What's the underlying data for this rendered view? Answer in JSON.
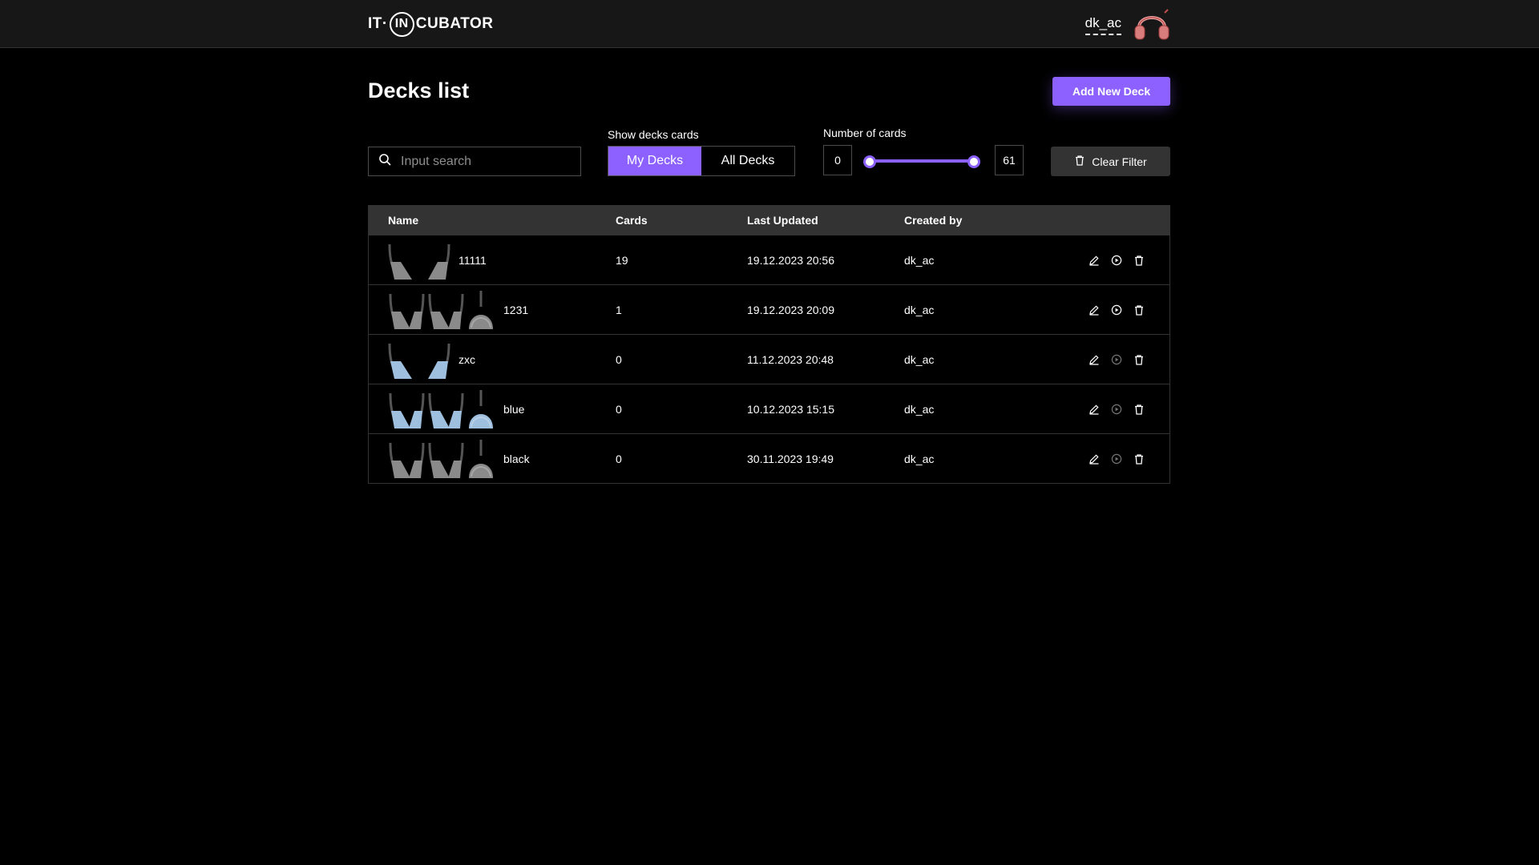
{
  "header": {
    "logo": {
      "left": "IT·",
      "circle": "IN",
      "right": "CUBATOR"
    },
    "user_name": "dk_ac",
    "avatar_icon": "headphones-avatar-icon"
  },
  "page": {
    "title": "Decks list",
    "add_button": "Add New Deck"
  },
  "filters": {
    "search_placeholder": "Input search",
    "search_value": "",
    "toggle_label": "Show decks cards",
    "toggle_options": [
      "My Decks",
      "All Decks"
    ],
    "toggle_selected": "My Decks",
    "range_label": "Number of cards",
    "range_min": "0",
    "range_max": "61",
    "clear_button": "Clear Filter"
  },
  "table": {
    "headers": [
      "Name",
      "Cards",
      "Last Updated",
      "Created by"
    ],
    "rows": [
      {
        "name": "11111",
        "cards": "19",
        "updated": "19.12.2023 20:56",
        "creator": "dk_ac",
        "learn_enabled": true,
        "color": "#8a8a8a"
      },
      {
        "name": "1231",
        "cards": "1",
        "updated": "19.12.2023 20:09",
        "creator": "dk_ac",
        "learn_enabled": true,
        "color": "#8a8a8a"
      },
      {
        "name": "zxc",
        "cards": "0",
        "updated": "11.12.2023 20:48",
        "creator": "dk_ac",
        "learn_enabled": false,
        "color": "#9fbfdf"
      },
      {
        "name": "blue",
        "cards": "0",
        "updated": "10.12.2023 15:15",
        "creator": "dk_ac",
        "learn_enabled": false,
        "color": "#9fbfdf"
      },
      {
        "name": "black",
        "cards": "0",
        "updated": "30.11.2023 19:49",
        "creator": "dk_ac",
        "learn_enabled": false,
        "color": "#8a8a8a"
      }
    ]
  },
  "colors": {
    "accent": "#8c61ff",
    "background": "#000000",
    "header_bg": "#171717",
    "table_header_bg": "#333333"
  }
}
